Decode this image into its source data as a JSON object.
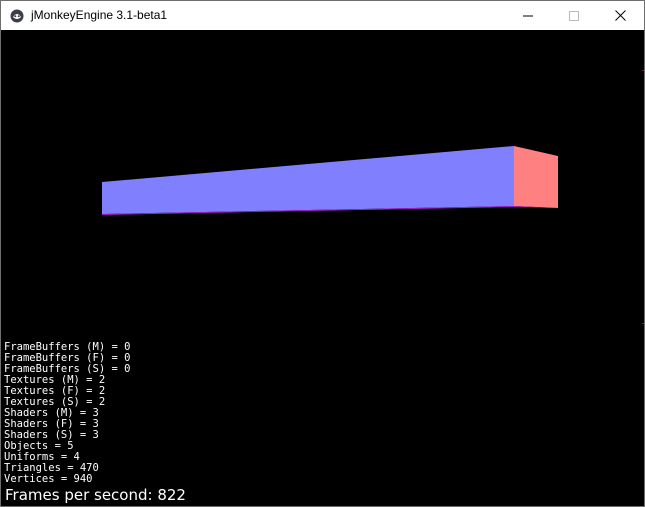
{
  "window": {
    "title": "jMonkeyEngine 3.1-beta1",
    "icon": "jmonkeyengine-logo-icon",
    "controls": [
      "minimize-icon",
      "maximize-icon",
      "close-icon"
    ]
  },
  "scene": {
    "background_color": "#000000",
    "box_front_color": "#8080ff",
    "box_side_color": "#ff8080",
    "box_bottom_edge_color": "#a020c0"
  },
  "stats": {
    "lines": [
      "FrameBuffers (M) = 0",
      "FrameBuffers (F) = 0",
      "FrameBuffers (S) = 0",
      "Textures (M) = 2",
      "Textures (F) = 2",
      "Textures (S) = 2",
      "Shaders (M) = 3",
      "Shaders (F) = 3",
      "Shaders (S) = 3",
      "Objects = 5",
      "Uniforms = 4",
      "Triangles = 470",
      "Vertices = 940"
    ],
    "fps_text": "Frames per second: 822"
  }
}
